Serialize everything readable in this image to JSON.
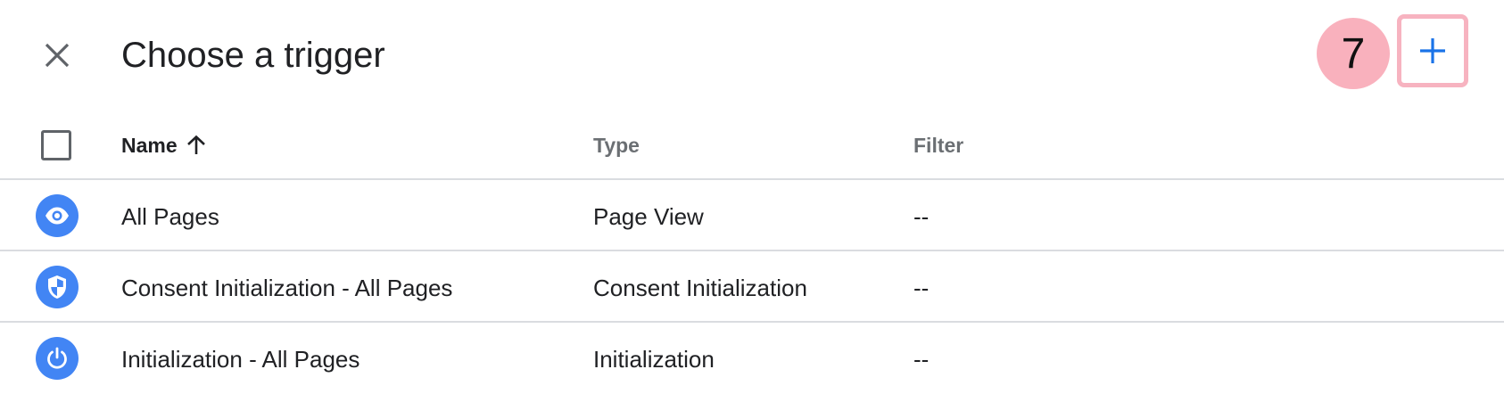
{
  "header": {
    "title": "Choose a trigger",
    "step_number": "7",
    "close_icon": "close-icon",
    "add_icon": "plus-icon"
  },
  "table": {
    "columns": {
      "name": "Name",
      "type": "Type",
      "filter": "Filter"
    },
    "sort": {
      "column": "Name",
      "direction": "ascending"
    },
    "rows": [
      {
        "icon": "eye-icon",
        "name": "All Pages",
        "type": "Page View",
        "filter": "--"
      },
      {
        "icon": "shield-icon",
        "name": "Consent Initialization - All Pages",
        "type": "Consent Initialization",
        "filter": "--"
      },
      {
        "icon": "power-icon",
        "name": "Initialization - All Pages",
        "type": "Initialization",
        "filter": "--"
      }
    ]
  },
  "colors": {
    "accent": "#4285f4",
    "highlight": "#f9b1bd",
    "divider": "#dadce0"
  }
}
